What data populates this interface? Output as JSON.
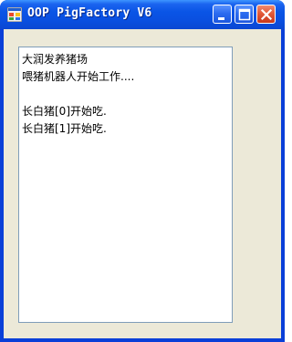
{
  "window": {
    "title": "OOP PigFactory V6",
    "icon": "app-window-icon",
    "controls": {
      "minimize_icon": "minimize-icon",
      "maximize_icon": "maximize-icon",
      "close_icon": "close-icon"
    }
  },
  "output": {
    "lines": [
      "大润发养猪场",
      "喂猪机器人开始工作....",
      "",
      "长白猪[0]开始吃.",
      "长白猪[1]开始吃."
    ]
  },
  "colors": {
    "titlebar": "#0a55e6",
    "client_bg": "#ece9d8",
    "close_button": "#e35b3a",
    "textbox_border": "#7f9db9"
  }
}
